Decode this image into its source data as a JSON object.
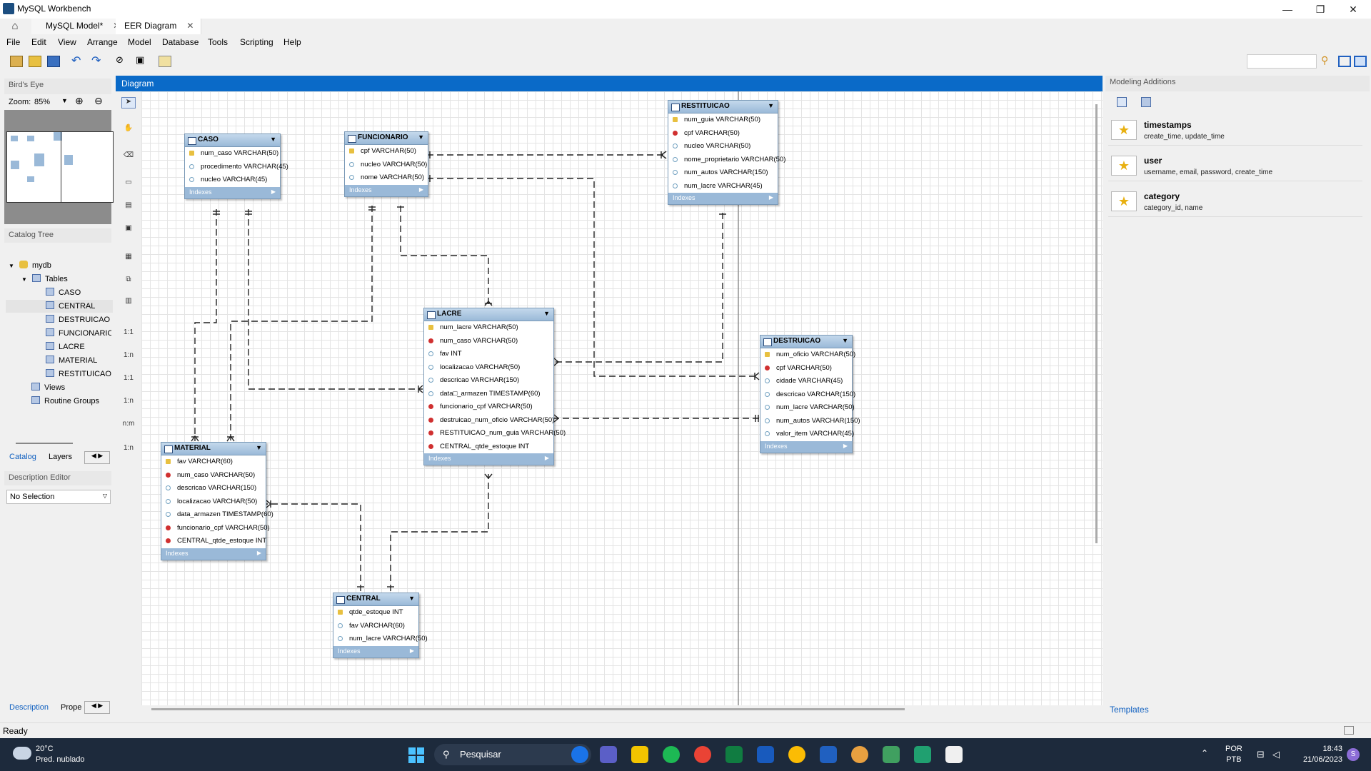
{
  "window": {
    "title": "MySQL Workbench",
    "minimize": "—",
    "restore": "❐",
    "close": "✕"
  },
  "tabs": [
    {
      "label": "MySQL Model*"
    },
    {
      "label": "EER Diagram"
    }
  ],
  "menu": [
    "File",
    "Edit",
    "View",
    "Arrange",
    "Model",
    "Database",
    "Tools",
    "Scripting",
    "Help"
  ],
  "left": {
    "birdseye_title": "Bird's Eye",
    "zoom_label": "Zoom:",
    "zoom_value": "85%",
    "catalog_title": "Catalog Tree",
    "tree": {
      "db": "mydb",
      "tables_label": "Tables",
      "tables": [
        "CASO",
        "CENTRAL",
        "DESTRUICAO",
        "FUNCIONARIO",
        "LACRE",
        "MATERIAL",
        "RESTITUICAO"
      ],
      "views": "Views",
      "routines": "Routine Groups"
    },
    "tab_catalog": "Catalog",
    "tab_layers": "Layers",
    "desc_title": "Description Editor",
    "desc_select": "No Selection",
    "tab_description": "Description",
    "tab_properties": "Prope"
  },
  "diagram": {
    "title": "Diagram",
    "entities": {
      "caso": {
        "name": "CASO",
        "cols": [
          {
            "k": "pk",
            "t": "num_caso VARCHAR(50)"
          },
          {
            "k": "nn",
            "t": "procedimento VARCHAR(45)"
          },
          {
            "k": "nn",
            "t": "nucleo VARCHAR(45)"
          }
        ]
      },
      "funcionario": {
        "name": "FUNCIONARIO",
        "cols": [
          {
            "k": "pk",
            "t": "cpf VARCHAR(50)"
          },
          {
            "k": "nn",
            "t": "nucleo VARCHAR(50)"
          },
          {
            "k": "nn",
            "t": "nome VARCHAR(50)"
          }
        ]
      },
      "restituicao": {
        "name": "RESTITUICAO",
        "cols": [
          {
            "k": "pk",
            "t": "num_guia VARCHAR(50)"
          },
          {
            "k": "fk",
            "t": "cpf VARCHAR(50)"
          },
          {
            "k": "nn",
            "t": "nucleo VARCHAR(50)"
          },
          {
            "k": "nn",
            "t": "nome_proprietario VARCHAR(50)"
          },
          {
            "k": "nn",
            "t": "num_autos VARCHAR(150)"
          },
          {
            "k": "nn",
            "t": "num_lacre VARCHAR(45)"
          }
        ]
      },
      "lacre": {
        "name": "LACRE",
        "cols": [
          {
            "k": "pk",
            "t": "num_lacre VARCHAR(50)"
          },
          {
            "k": "fk",
            "t": "num_caso VARCHAR(50)"
          },
          {
            "k": "nn",
            "t": "fav INT"
          },
          {
            "k": "nn",
            "t": "localizacao VARCHAR(50)"
          },
          {
            "k": "nn",
            "t": "descricao VARCHAR(150)"
          },
          {
            "k": "nn",
            "t": "data□_armazen TIMESTAMP(60)"
          },
          {
            "k": "fk",
            "t": "funcionario_cpf VARCHAR(50)"
          },
          {
            "k": "fk",
            "t": "destruicao_num_oficio VARCHAR(50)"
          },
          {
            "k": "fk",
            "t": "RESTITUICAO_num_guia VARCHAR(50)"
          },
          {
            "k": "fk",
            "t": "CENTRAL_qtde_estoque INT"
          }
        ]
      },
      "destruicao": {
        "name": "DESTRUICAO",
        "cols": [
          {
            "k": "pk",
            "t": "num_oficio VARCHAR(50)"
          },
          {
            "k": "fk",
            "t": "cpf VARCHAR(50)"
          },
          {
            "k": "nn",
            "t": "cidade VARCHAR(45)"
          },
          {
            "k": "nn",
            "t": "descricao VARCHAR(150)"
          },
          {
            "k": "nn",
            "t": "num_lacre VARCHAR(50)"
          },
          {
            "k": "nn",
            "t": "num_autos VARCHAR(150)"
          },
          {
            "k": "nn",
            "t": "valor_item VARCHAR(45)"
          }
        ]
      },
      "material": {
        "name": "MATERIAL",
        "cols": [
          {
            "k": "pk",
            "t": "fav VARCHAR(60)"
          },
          {
            "k": "fk",
            "t": "num_caso VARCHAR(50)"
          },
          {
            "k": "nn",
            "t": "descricao VARCHAR(150)"
          },
          {
            "k": "nn",
            "t": "localizacao VARCHAR(50)"
          },
          {
            "k": "nn",
            "t": "data_armazen TIMESTAMP(60)"
          },
          {
            "k": "fk",
            "t": "funcionario_cpf VARCHAR(50)"
          },
          {
            "k": "fk",
            "t": "CENTRAL_qtde_estoque INT"
          }
        ]
      },
      "central": {
        "name": "CENTRAL",
        "cols": [
          {
            "k": "pk",
            "t": "qtde_estoque INT"
          },
          {
            "k": "nn",
            "t": "fav VARCHAR(60)"
          },
          {
            "k": "nn",
            "t": "num_lacre VARCHAR(50)"
          }
        ]
      }
    },
    "indexes_label": "Indexes"
  },
  "right": {
    "title": "Modeling Additions",
    "templates": [
      {
        "name": "timestamps",
        "cols": "create_time, update_time"
      },
      {
        "name": "user",
        "cols": "username, email, password, create_time"
      },
      {
        "name": "category",
        "cols": "category_id, name"
      }
    ],
    "tab_templates": "Templates"
  },
  "status": "Ready",
  "taskbar": {
    "temp": "20°C",
    "weather": "Pred. nublado",
    "search": "Pesquisar",
    "lang1": "POR",
    "lang2": "PTB",
    "time": "18:43",
    "date": "21/06/2023",
    "avatar": "S"
  }
}
